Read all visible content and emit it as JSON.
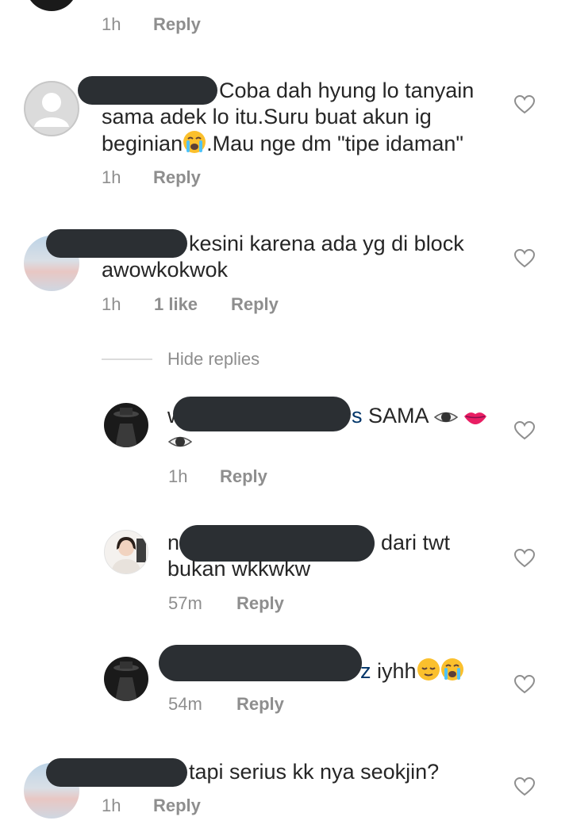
{
  "top": {
    "time": "1h",
    "reply": "Reply"
  },
  "c1": {
    "line1": "Coba dah hyung lo tanyain",
    "line2": "sama adek lo itu.Suru buat akun ig",
    "line3a": "beginian",
    "line3b": ".Mau nge dm \"tipe idaman\"",
    "time": "1h",
    "reply": "Reply"
  },
  "c2": {
    "line1": "kesini karena ada yg di block",
    "line2": "awowkokwok",
    "time": "1h",
    "likes": "1 like",
    "reply": "Reply"
  },
  "hide_replies": "Hide replies",
  "r1": {
    "prefix": "w",
    "suffix": "s",
    "text": " SAMA",
    "time": "1h",
    "reply": "Reply"
  },
  "r2": {
    "prefix": "n",
    "text": "dari twt",
    "line2": "bukan wkkwkw",
    "time": "57m",
    "reply": "Reply"
  },
  "r3": {
    "suffix": "z",
    "text": " iyhh",
    "time": "54m",
    "reply": "Reply"
  },
  "c3": {
    "text": "tapi serius kk nya seokjin?",
    "time": "1h",
    "reply": "Reply"
  },
  "icons": {
    "heart": "heart-outline-icon",
    "crying": "loudly-crying-face-emoji",
    "eye": "eye-emoji",
    "lips": "lips-emoji",
    "pensive": "relieved-face-emoji"
  },
  "colors": {
    "text": "#262626",
    "meta": "#8e8e8e",
    "mention": "#003569",
    "redaction": "#2b2f33"
  }
}
